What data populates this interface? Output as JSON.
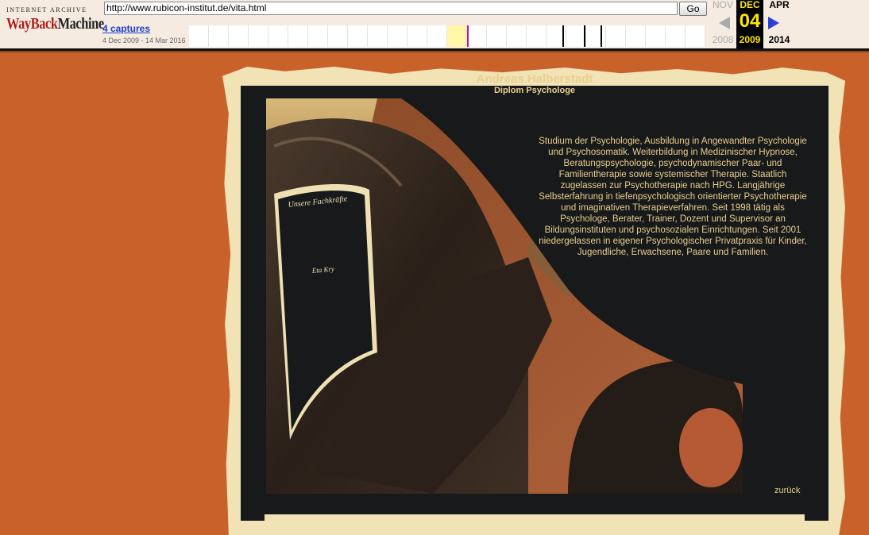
{
  "wayback": {
    "logo_top": "INTERNET ARCHIVE",
    "logo_way": "Way",
    "logo_back": "Back",
    "logo_machine": "Machine",
    "url": "http://www.rubicon-institut.de/vita.html",
    "go_label": "Go",
    "captures_label": "4 captures",
    "date_range": "4 Dec 2009 - 14 Mar 2016",
    "prev": {
      "month": "NOV",
      "year": "2008"
    },
    "current": {
      "month": "DEC",
      "day": "04",
      "year": "2009"
    },
    "next": {
      "month": "APR",
      "year": "2014"
    }
  },
  "site": {
    "name": "Andreas Halberstadt",
    "subtitle": "Diplom Psychologe",
    "sign_title": "Unsere Fachkräfte",
    "sign_name": "Eta Kry",
    "bio": "Studium der Psychologie, Ausbildung in Angewandter Psychologie und Psychosomatik. Weiterbildung in Medizinischer Hypnose, Beratungspsychologie, psychodynamischer Paar- und Familientherapie sowie systemischer Therapie. Staatlich zugelassen zur Psychotherapie nach HPG. Langjährige Selbsterfahrung in tiefenpsychologisch orientierter Psychotherapie und imaginativen Therapieverfahren. Seit 1998 tätig als Psychologe, Berater, Trainer, Dozent und Supervisor an Bildungsinstituten und psychosozialen Einrichtungen. Seit 2001 niedergelassen in eigener Psychologischer Privatpraxis für Kinder, Jugendliche, Erwachsene, Paare und Familien.",
    "back_link": "zurück"
  },
  "colors": {
    "page_bg": "#c8622a",
    "panel_bg": "#17191a",
    "text_gold": "#e8cf8e",
    "frame": "#f1e3b6"
  }
}
